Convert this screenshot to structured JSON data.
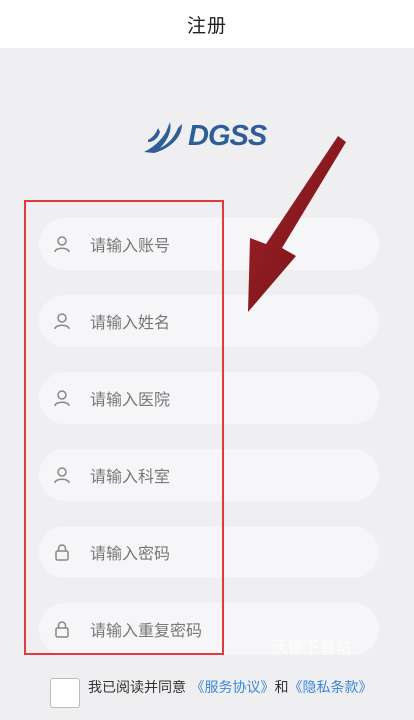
{
  "header": {
    "title": "注册"
  },
  "logo": {
    "text": "DGSS"
  },
  "form": {
    "fields": [
      {
        "placeholder": "请输入账号",
        "icon": "user-icon"
      },
      {
        "placeholder": "请输入姓名",
        "icon": "user-icon"
      },
      {
        "placeholder": "请输入医院",
        "icon": "user-icon"
      },
      {
        "placeholder": "请输入科室",
        "icon": "user-icon"
      },
      {
        "placeholder": "请输入密码",
        "icon": "lock-icon"
      },
      {
        "placeholder": "请输入重复密码",
        "icon": "lock-icon"
      }
    ]
  },
  "agreement": {
    "prefix": "我已阅读并同意 ",
    "service_link": "《服务协议》",
    "and": "和",
    "privacy_link": "《隐私条款》"
  },
  "watermark": {
    "text": "沃德下载站"
  },
  "colors": {
    "highlight_box": "#e0393e",
    "arrow": "#8b1a1e",
    "link": "#3b87d8",
    "logo": "#2f5e96"
  }
}
